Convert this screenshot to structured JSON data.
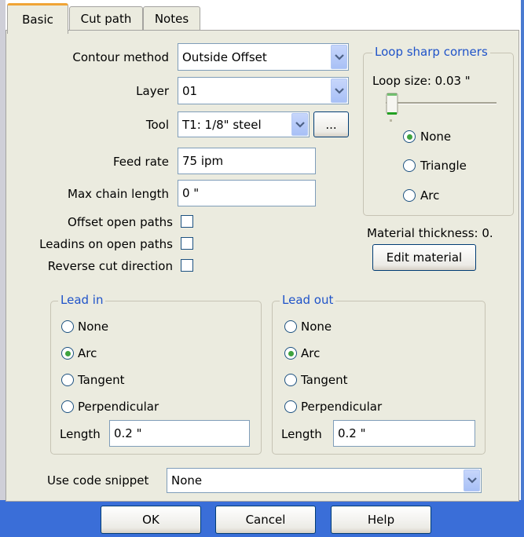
{
  "tabs": [
    {
      "label": "Basic",
      "active": true
    },
    {
      "label": "Cut path",
      "active": false
    },
    {
      "label": "Notes",
      "active": false
    }
  ],
  "contour_method": {
    "label": "Contour method",
    "value": "Outside Offset"
  },
  "layer": {
    "label": "Layer",
    "value": "01"
  },
  "tool": {
    "label": "Tool",
    "value": "T1: 1/8\" steel",
    "browse_label": "..."
  },
  "feed_rate": {
    "label": "Feed rate",
    "value": "75 ipm"
  },
  "max_chain_length": {
    "label": "Max chain length",
    "value": "0 \""
  },
  "checkboxes": {
    "offset_open_paths": {
      "label": "Offset open paths",
      "checked": false
    },
    "leadins_open_paths": {
      "label": "Leadins on open paths",
      "checked": false
    },
    "reverse_cut": {
      "label": "Reverse cut direction",
      "checked": false
    }
  },
  "loop_corners": {
    "title": "Loop sharp corners",
    "loop_size_label": "Loop size: 0.03 \"",
    "slider_level": 0.0,
    "options": [
      "None",
      "Triangle",
      "Arc"
    ],
    "selected": "None"
  },
  "material": {
    "thickness_label": "Material thickness: 0.",
    "edit_button": "Edit material"
  },
  "lead_in": {
    "title": "Lead in",
    "options": [
      "None",
      "Arc",
      "Tangent",
      "Perpendicular"
    ],
    "selected": "Arc",
    "length_label": "Length",
    "length_value": "0.2 \""
  },
  "lead_out": {
    "title": "Lead out",
    "options": [
      "None",
      "Arc",
      "Tangent",
      "Perpendicular"
    ],
    "selected": "Arc",
    "length_label": "Length",
    "length_value": "0.2 \""
  },
  "code_snippet": {
    "label": "Use code snippet",
    "value": "None"
  },
  "buttons": {
    "ok": "OK",
    "cancel": "Cancel",
    "help": "Help"
  },
  "colors": {
    "panel_bg": "#ebebdf",
    "group_title": "#1f53c9",
    "radio_selected": "#3fa33f",
    "active_tab_accent": "#f0a436",
    "bottom_bar": "#3a6ed8"
  },
  "icons": {
    "dropdown": "chevron-down-icon",
    "slider_thumb": "slider-thumb-icon"
  }
}
